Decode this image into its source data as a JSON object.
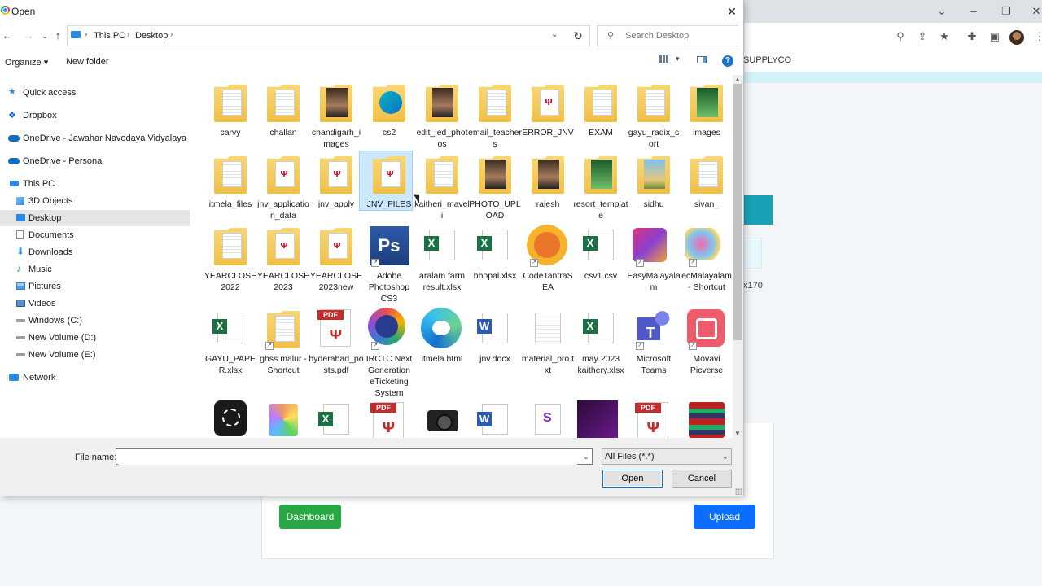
{
  "dialog": {
    "title": "Open",
    "address": {
      "segments": [
        "This PC",
        "Desktop"
      ]
    },
    "search_placeholder": "Search Desktop",
    "commands": {
      "organize": "Organize ▾",
      "new_folder": "New folder"
    },
    "nav": {
      "quick_access": "Quick access",
      "dropbox": "Dropbox",
      "onedrive_school": "OneDrive - Jawahar Navodaya Vidyalaya",
      "onedrive_personal": "OneDrive - Personal",
      "this_pc": "This PC",
      "objects3d": "3D Objects",
      "desktop": "Desktop",
      "documents": "Documents",
      "downloads": "Downloads",
      "music": "Music",
      "pictures": "Pictures",
      "videos": "Videos",
      "windows_c": "Windows (C:)",
      "new_volume_d": "New Volume (D:)",
      "new_volume_e": "New Volume (E:)",
      "network": "Network"
    },
    "files": [
      {
        "name": "carvy",
        "icon": "folder-icon"
      },
      {
        "name": "challan",
        "icon": "folder-icon"
      },
      {
        "name": "chandigarh_images",
        "icon": "folder-icon"
      },
      {
        "name": "cs2",
        "icon": "folder-icon"
      },
      {
        "name": "edit_ied_photos",
        "icon": "folder-icon"
      },
      {
        "name": "email_teachers",
        "icon": "folder-icon"
      },
      {
        "name": "ERROR_JNV",
        "icon": "folder-icon"
      },
      {
        "name": "EXAM",
        "icon": "folder-icon"
      },
      {
        "name": "gayu_radix_sort",
        "icon": "folder-icon"
      },
      {
        "name": "images",
        "icon": "folder-icon"
      },
      {
        "name": "itmela_files",
        "icon": "folder-icon"
      },
      {
        "name": "jnv_application_data",
        "icon": "folder-icon"
      },
      {
        "name": "jnv_apply",
        "icon": "folder-icon"
      },
      {
        "name": "JNV_FILES",
        "icon": "folder-icon"
      },
      {
        "name": "kaitheri_maveli",
        "icon": "folder-icon"
      },
      {
        "name": "PHOTO_UPLOAD",
        "icon": "folder-icon"
      },
      {
        "name": "rajesh",
        "icon": "folder-icon"
      },
      {
        "name": "resort_template",
        "icon": "folder-icon"
      },
      {
        "name": "sidhu",
        "icon": "folder-icon"
      },
      {
        "name": "sivan_",
        "icon": "folder-icon"
      },
      {
        "name": "YEARCLOSE2022",
        "icon": "folder-icon"
      },
      {
        "name": "YEARCLOSE2023",
        "icon": "folder-icon"
      },
      {
        "name": "YEARCLOSE2023new",
        "icon": "folder-icon"
      },
      {
        "name": "Adobe Photoshop CS3",
        "icon": "photoshop-icon"
      },
      {
        "name": "aralam farm result.xlsx",
        "icon": "excel-icon"
      },
      {
        "name": "bhopal.xlsx",
        "icon": "excel-icon"
      },
      {
        "name": "CodeTantraSEA",
        "icon": "codetantra-icon"
      },
      {
        "name": "csv1.csv",
        "icon": "excel-csv-icon"
      },
      {
        "name": "EasyMalayalam",
        "icon": "easymalayalam-icon"
      },
      {
        "name": "ecMalayalam - Shortcut",
        "icon": "ecmalayalam-icon"
      },
      {
        "name": "GAYU_PAPER.xlsx",
        "icon": "excel-icon"
      },
      {
        "name": "ghss malur - Shortcut",
        "icon": "folder-icon"
      },
      {
        "name": "hyderabad_posts.pdf",
        "icon": "pdf-icon"
      },
      {
        "name": "IRCTC Next Generation eTicketing System",
        "icon": "irctc-icon"
      },
      {
        "name": "itmela.html",
        "icon": "edge-icon"
      },
      {
        "name": "jnv.docx",
        "icon": "word-icon"
      },
      {
        "name": "material_pro.txt",
        "icon": "text-file-icon"
      },
      {
        "name": "may 2023 kaithery.xlsx",
        "icon": "excel-icon"
      },
      {
        "name": "Microsoft Teams",
        "icon": "teams-icon"
      },
      {
        "name": "Movavi Picverse",
        "icon": "movavi-icon"
      }
    ],
    "file_name_label": "File name:",
    "file_name_value": "",
    "file_type": "All Files (*.*)",
    "open_label": "Open",
    "cancel_label": "Cancel"
  },
  "background": {
    "bookmark": "SUPPLYCO",
    "snippet": "x170",
    "dashboard_label": "Dashboard",
    "upload_label": "Upload"
  }
}
